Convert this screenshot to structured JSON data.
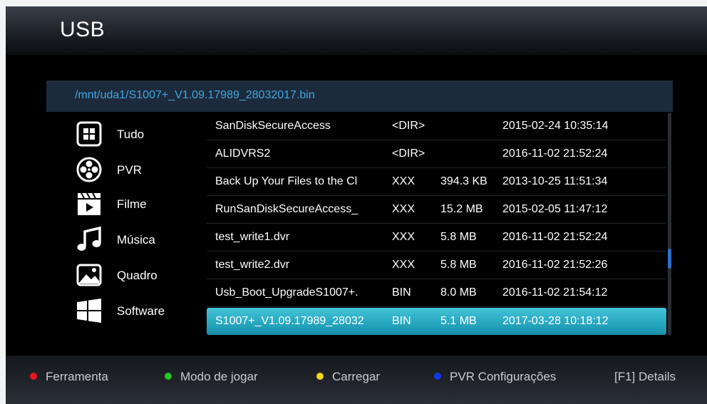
{
  "header": {
    "title": "USB"
  },
  "path": "/mnt/uda1/S1007+_V1.09.17989_28032017.bin",
  "categories": [
    {
      "label": "Tudo",
      "icon": "grid-icon"
    },
    {
      "label": "PVR",
      "icon": "film-reel-icon"
    },
    {
      "label": "Filme",
      "icon": "clapperboard-icon"
    },
    {
      "label": "Música",
      "icon": "music-note-icon"
    },
    {
      "label": "Quadro",
      "icon": "picture-icon"
    },
    {
      "label": "Software",
      "icon": "windows-icon"
    }
  ],
  "files": [
    {
      "name": "SanDiskSecureAccess",
      "type": "<DIR>",
      "size": "",
      "date": "2015-02-24 10:35:14"
    },
    {
      "name": "ALIDVRS2",
      "type": "<DIR>",
      "size": "",
      "date": "2016-11-02 21:52:24"
    },
    {
      "name": "Back Up Your Files to the Cl",
      "type": "XXX",
      "size": "394.3 KB",
      "date": "2013-10-25 11:51:34"
    },
    {
      "name": "RunSanDiskSecureAccess_",
      "type": "XXX",
      "size": "15.2 MB",
      "date": "2015-02-05 11:47:12"
    },
    {
      "name": "test_write1.dvr",
      "type": "XXX",
      "size": "5.8 MB",
      "date": "2016-11-02 21:52:24"
    },
    {
      "name": "test_write2.dvr",
      "type": "XXX",
      "size": "5.8 MB",
      "date": "2016-11-02 21:52:26"
    },
    {
      "name": "Usb_Boot_UpgradeS1007+.",
      "type": "BIN",
      "size": "8.0 MB",
      "date": "2016-11-02 21:54:12"
    },
    {
      "name": "S1007+_V1.09.17989_28032",
      "type": "BIN",
      "size": "5.1 MB",
      "date": "2017-03-28 10:18:12"
    }
  ],
  "selected_index": 7,
  "scroll_position": 0.67,
  "footer": {
    "hints": [
      {
        "label": "Ferramenta",
        "color": "#e8161b"
      },
      {
        "label": "Modo de jogar",
        "color": "#22c81e"
      },
      {
        "label": "Carregar",
        "color": "#f4d816"
      },
      {
        "label": "PVR Configurações",
        "color": "#1436e6"
      }
    ],
    "f1_key": "[F1]",
    "f1_label": "Details"
  },
  "colors": {
    "path_text": "#3ea8e0",
    "selection": "#2ab0c8",
    "scroll_thumb": "#2f6fc8"
  }
}
